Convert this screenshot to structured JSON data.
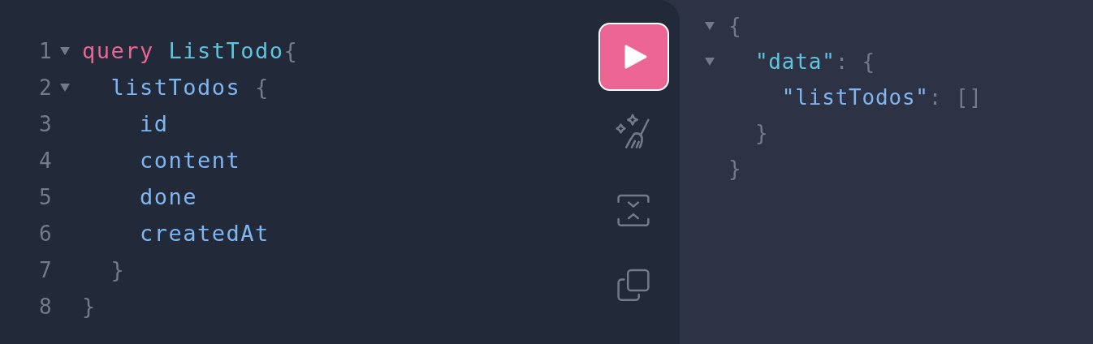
{
  "editor": {
    "lines": [
      {
        "number": "1",
        "foldable": true,
        "tokens": [
          {
            "text": "query",
            "kind": "keyword"
          },
          {
            "text": " ListTodo",
            "kind": "name"
          },
          {
            "text": "{",
            "kind": "punct"
          }
        ]
      },
      {
        "number": "2",
        "foldable": true,
        "tokens": [
          {
            "text": "  listTodos",
            "kind": "field"
          },
          {
            "text": " {",
            "kind": "punct"
          }
        ]
      },
      {
        "number": "3",
        "foldable": false,
        "tokens": [
          {
            "text": "    id",
            "kind": "field"
          }
        ]
      },
      {
        "number": "4",
        "foldable": false,
        "tokens": [
          {
            "text": "    content",
            "kind": "field"
          }
        ]
      },
      {
        "number": "5",
        "foldable": false,
        "tokens": [
          {
            "text": "    done",
            "kind": "field"
          }
        ]
      },
      {
        "number": "6",
        "foldable": false,
        "tokens": [
          {
            "text": "    createdAt",
            "kind": "field"
          }
        ]
      },
      {
        "number": "7",
        "foldable": false,
        "tokens": [
          {
            "text": "  }",
            "kind": "punct"
          }
        ]
      },
      {
        "number": "8",
        "foldable": false,
        "tokens": [
          {
            "text": "}",
            "kind": "punct"
          }
        ]
      }
    ]
  },
  "toolbar": [
    {
      "kind": "run"
    },
    {
      "kind": "prettify"
    },
    {
      "kind": "merge"
    },
    {
      "kind": "copy"
    }
  ],
  "result": {
    "lines": [
      {
        "foldable": true,
        "tokens": [
          {
            "text": "{",
            "kind": "punct"
          }
        ]
      },
      {
        "foldable": true,
        "tokens": [
          {
            "text": "  \"data\"",
            "kind": "name"
          },
          {
            "text": ": {",
            "kind": "punct"
          }
        ]
      },
      {
        "foldable": false,
        "tokens": [
          {
            "text": "    \"listTodos\"",
            "kind": "field"
          },
          {
            "text": ": []",
            "kind": "punct"
          }
        ]
      },
      {
        "foldable": false,
        "tokens": [
          {
            "text": "  }",
            "kind": "punct"
          }
        ]
      },
      {
        "foldable": false,
        "tokens": [
          {
            "text": "}",
            "kind": "punct"
          }
        ]
      }
    ]
  }
}
